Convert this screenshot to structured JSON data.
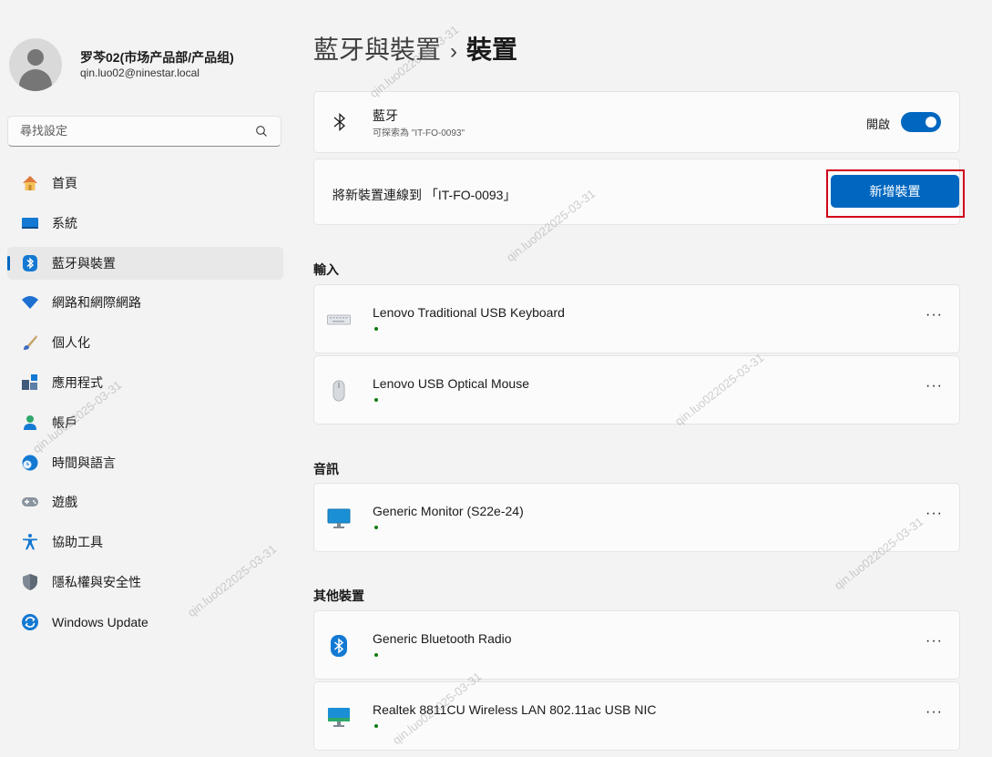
{
  "profile": {
    "name": "罗芩02(市场产品部/产品组)",
    "email": "qin.luo02@ninestar.local"
  },
  "search": {
    "placeholder": "尋找設定"
  },
  "nav": [
    {
      "label": "首頁",
      "icon": "home-icon"
    },
    {
      "label": "系統",
      "icon": "system-icon"
    },
    {
      "label": "藍牙與裝置",
      "icon": "bluetooth-icon",
      "active": true
    },
    {
      "label": "網路和網際網路",
      "icon": "wifi-icon"
    },
    {
      "label": "個人化",
      "icon": "brush-icon"
    },
    {
      "label": "應用程式",
      "icon": "apps-icon"
    },
    {
      "label": "帳戶",
      "icon": "account-icon"
    },
    {
      "label": "時間與語言",
      "icon": "clock-globe-icon"
    },
    {
      "label": "遊戲",
      "icon": "gamepad-icon"
    },
    {
      "label": "協助工具",
      "icon": "accessibility-icon"
    },
    {
      "label": "隱私權與安全性",
      "icon": "shield-icon"
    },
    {
      "label": "Windows Update",
      "icon": "update-icon"
    }
  ],
  "header": {
    "parent": "藍牙與裝置",
    "separator": "›",
    "current": "裝置"
  },
  "bluetooth": {
    "title": "藍牙",
    "subtitle": "可探索為 \"IT-FO-0093\"",
    "toggle_label": "開啟",
    "toggle_on": true
  },
  "add_device": {
    "text": "將新裝置連線到 「IT-FO-0093」",
    "button_label": "新增裝置"
  },
  "sections": {
    "input": {
      "title": "輸入",
      "devices": [
        {
          "name": "Lenovo Traditional USB Keyboard",
          "icon": "keyboard-icon"
        },
        {
          "name": "Lenovo USB Optical Mouse",
          "icon": "mouse-icon"
        }
      ]
    },
    "audio": {
      "title": "音訊",
      "devices": [
        {
          "name": "Generic Monitor (S22e-24)",
          "icon": "monitor-icon"
        }
      ]
    },
    "other": {
      "title": "其他裝置",
      "devices": [
        {
          "name": "Generic Bluetooth Radio",
          "icon": "bluetooth-icon"
        },
        {
          "name": "Realtek 8811CU Wireless LAN 802.11ac USB NIC",
          "icon": "network-adapter-icon"
        }
      ]
    }
  },
  "more_label": "···",
  "watermark": "qin.luo022025-03-31",
  "colors": {
    "accent": "#0067c0",
    "highlight_border": "#d0021b",
    "status_ok": "#107c10"
  }
}
